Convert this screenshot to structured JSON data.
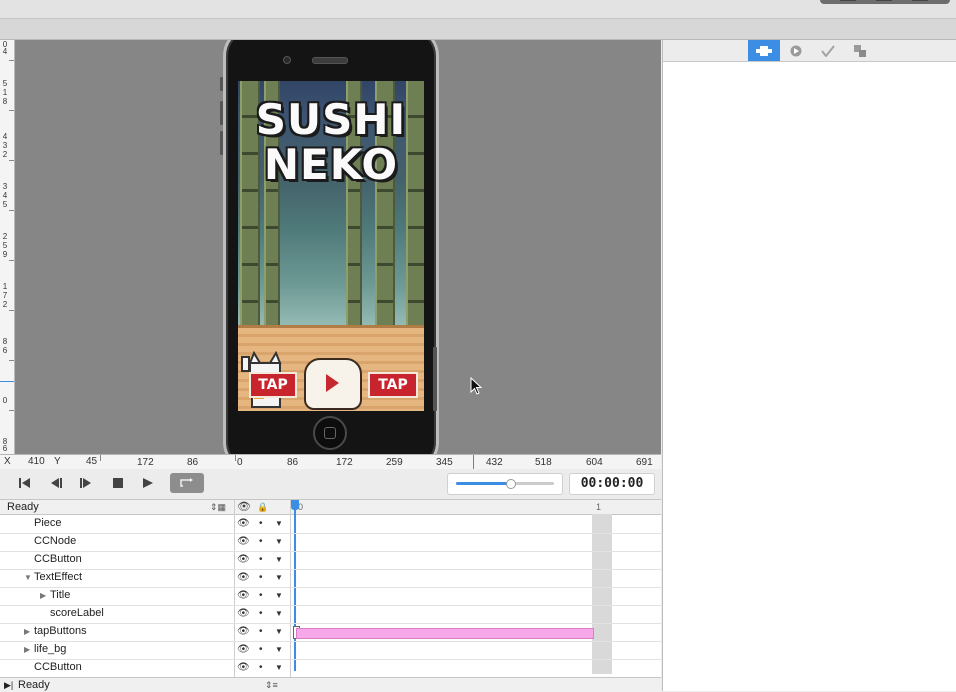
{
  "ruler": {
    "x_label": "X",
    "x_value": "410",
    "y_label": "Y",
    "y_value": "45",
    "x_ticks": [
      "172",
      "86",
      "0",
      "86",
      "172",
      "259",
      "345",
      "432",
      "518",
      "604",
      "691"
    ],
    "y_ticks": [
      "0",
      "4",
      "5",
      "1",
      "8",
      "4",
      "3",
      "2",
      "3",
      "4",
      "5",
      "2",
      "5",
      "9",
      "1",
      "7",
      "2",
      "8",
      "6",
      "0",
      "8",
      "6"
    ]
  },
  "transport": {
    "first_icon": "skip-to-start-icon",
    "prev_icon": "step-back-icon",
    "play_icon": "play-icon",
    "stop_icon": "stop-icon",
    "next_icon": "step-forward-icon",
    "loop_icon": "loop-icon",
    "scale_fraction": 0.55,
    "time": "00:00:00"
  },
  "timeline": {
    "sequence_name": "Ready",
    "marker_start": "0",
    "marker_end": "1",
    "nodes": [
      {
        "name": "Piece",
        "indent": 1,
        "disclosure": ""
      },
      {
        "name": "CCNode",
        "indent": 1,
        "disclosure": ""
      },
      {
        "name": "CCButton",
        "indent": 1,
        "disclosure": ""
      },
      {
        "name": "TextEffect",
        "indent": 1,
        "disclosure": "▼"
      },
      {
        "name": "Title",
        "indent": 2,
        "disclosure": "▶"
      },
      {
        "name": "scoreLabel",
        "indent": 2,
        "disclosure": ""
      },
      {
        "name": "tapButtons",
        "indent": 1,
        "disclosure": "▶"
      },
      {
        "name": "life_bg",
        "indent": 1,
        "disclosure": "▶"
      },
      {
        "name": "CCButton",
        "indent": 1,
        "disclosure": ""
      }
    ],
    "status_text": "Ready",
    "visibility_icon": "eye-icon",
    "lock_icon": "lock-icon",
    "row_marker": "•",
    "row_arrow": "▼"
  },
  "game_preview": {
    "title_line1": "SUSHI",
    "title_line2": "NEKO",
    "tap_left": "TAP",
    "tap_right": "TAP",
    "play_icon": "play-triangle-icon"
  },
  "inspector": {
    "tabs": [
      {
        "icon": "node-properties-icon",
        "active": true
      },
      {
        "icon": "code-connections-icon",
        "active": false
      },
      {
        "icon": "physics-icon",
        "active": false
      },
      {
        "icon": "template-icon",
        "active": false
      }
    ]
  },
  "colors": {
    "accent": "#3b8ee3",
    "canvas_bg": "#868686",
    "keyframe": "#f7a8e8"
  }
}
